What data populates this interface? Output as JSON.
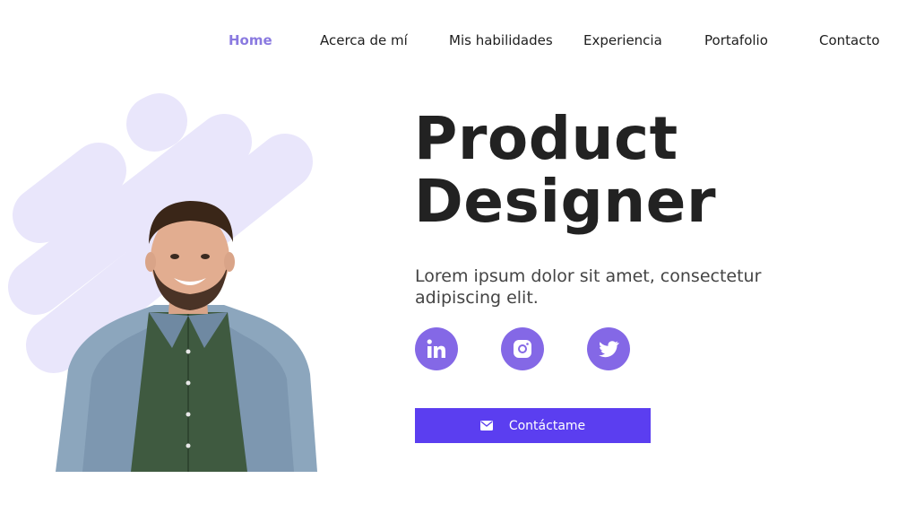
{
  "nav": {
    "items": [
      {
        "label": "Home",
        "active": true
      },
      {
        "label": "Acerca de mí"
      },
      {
        "label": "Mis habilidades"
      },
      {
        "label": "Experiencia"
      },
      {
        "label": "Portafolio"
      },
      {
        "label": "Contacto"
      }
    ]
  },
  "hero": {
    "title": "Product\nDesigner",
    "description": "Lorem ipsum dolor sit amet, consectetur adipiscing elit.",
    "socials": [
      {
        "icon": "linkedin-icon"
      },
      {
        "icon": "instagram-icon"
      },
      {
        "icon": "twitter-icon"
      }
    ],
    "cta_label": "Contáctame",
    "cta_icon": "mail-icon"
  },
  "colors": {
    "accent": "#5b3ef0",
    "social_bg": "#8468e6",
    "nav_active": "#8a7ae0",
    "deco": "#e9e6fb"
  }
}
